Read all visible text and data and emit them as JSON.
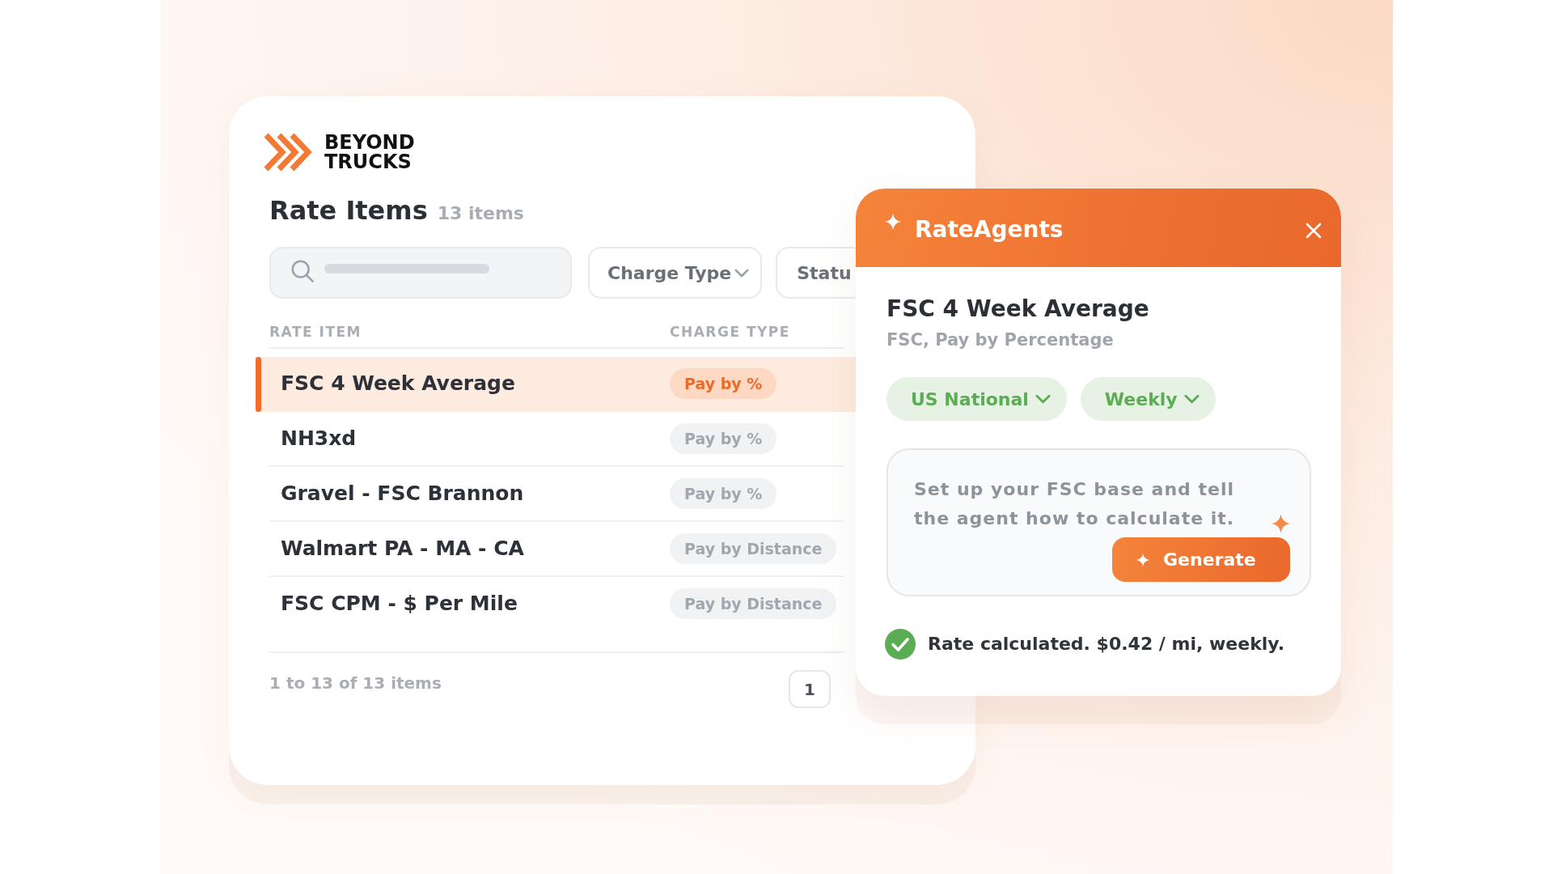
{
  "logo": {
    "lines": [
      "BEYOND",
      "TRUCKS"
    ]
  },
  "page": {
    "title": "Rate Items",
    "count": "13 items"
  },
  "filters": [
    {
      "label": "Charge Type",
      "clipped": false
    },
    {
      "label": "Statu",
      "clipped": true
    }
  ],
  "table": {
    "columns": [
      "RATE ITEM",
      "CHARGE TYPE"
    ],
    "rows": [
      {
        "name": "FSC 4 Week Average",
        "charge_type": "Pay by %",
        "selected": true
      },
      {
        "name": "NH3xd",
        "charge_type": "Pay by %",
        "selected": false
      },
      {
        "name": "Gravel - FSC Brannon",
        "charge_type": "Pay by %",
        "selected": false
      },
      {
        "name": "Walmart PA - MA - CA",
        "charge_type": "Pay by Distance",
        "selected": false
      },
      {
        "name": "FSC CPM - $ Per Mile",
        "charge_type": "Pay by Distance",
        "selected": false
      }
    ]
  },
  "pagination": {
    "summary": "1 to 13 of 13 items",
    "pages": [
      "1"
    ]
  },
  "agent_panel": {
    "title": "RateAgents",
    "item_title": "FSC 4 Week Average",
    "item_subtitle": "FSC, Pay by Percentage",
    "selectors": [
      "US National",
      "Weekly"
    ],
    "prompt": {
      "placeholder": "Set up your FSC base and tell the agent how to calculate it."
    },
    "generate_button": "Generate",
    "result": "Rate calculated. $0.42 / mi, weekly."
  }
}
